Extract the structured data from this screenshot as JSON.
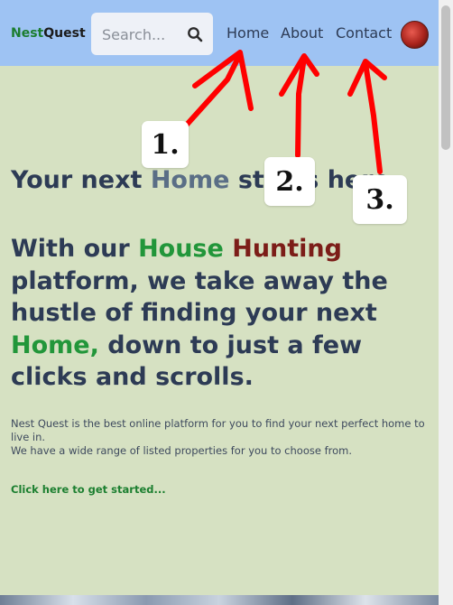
{
  "nav": {
    "brand_part1": "Nest",
    "brand_part2": "Quest",
    "search_placeholder": "Search...",
    "links": [
      "Home",
      "About",
      "Contact"
    ]
  },
  "hero": {
    "tagline_1": "Your next ",
    "tagline_accent": "Home",
    "tagline_2": " starts here",
    "heading_1": "With our ",
    "heading_green_1": "House",
    "heading_darkred": " Hunting",
    "heading_2": " platform, we take away the hustle of finding your next ",
    "heading_green_2": "Home,",
    "heading_3": " down to just a few clicks and scrolls.",
    "intro_line1": "Nest Quest is the best online platform for you to find your next perfect home to live in.",
    "intro_line2": "We have a wide range of listed properties for you to choose from.",
    "cta": "Click here to get started..."
  },
  "annotations": {
    "callouts": [
      "1.",
      "2.",
      "3."
    ],
    "arrow_color": "#ff0000"
  },
  "colors": {
    "page_bg": "#d6e1c2",
    "navbar_bg": "#9ec3f3",
    "heading": "#2d3b55",
    "green_accent": "#22963a",
    "darkred_accent": "#7c1d18"
  }
}
